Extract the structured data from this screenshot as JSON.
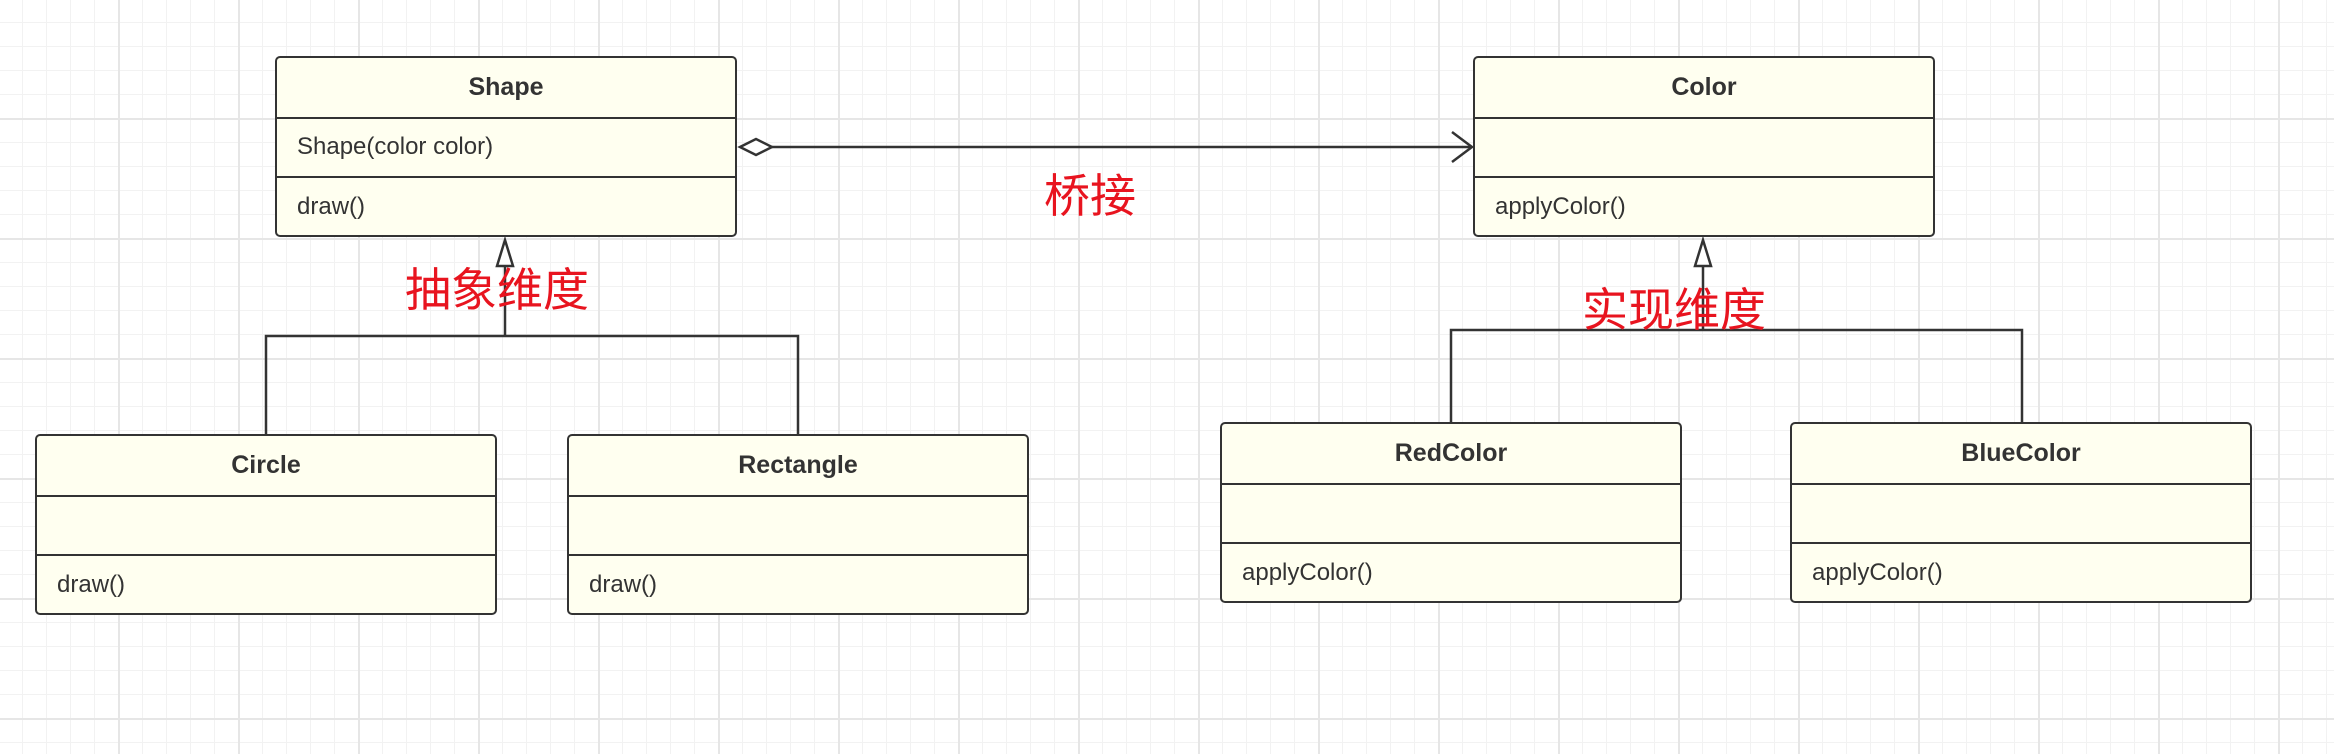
{
  "classes": {
    "shape": {
      "name": "Shape",
      "attributes": "Shape(color color)",
      "methods": "draw()"
    },
    "color": {
      "name": "Color",
      "attributes": "",
      "methods": "applyColor()"
    },
    "circle": {
      "name": "Circle",
      "attributes": "",
      "methods": "draw()"
    },
    "rectangle": {
      "name": "Rectangle",
      "attributes": "",
      "methods": "draw()"
    },
    "redcolor": {
      "name": "RedColor",
      "attributes": "",
      "methods": "applyColor()"
    },
    "bluecolor": {
      "name": "BlueColor",
      "attributes": "",
      "methods": "applyColor()"
    }
  },
  "labels": {
    "bridge": "桥接",
    "abstraction": "抽象维度",
    "implementation": "实现维度"
  },
  "colors": {
    "class_fill": "#fffff0",
    "stroke": "#333333",
    "label_red": "#e8141f",
    "grid": "#e6e6e6"
  }
}
